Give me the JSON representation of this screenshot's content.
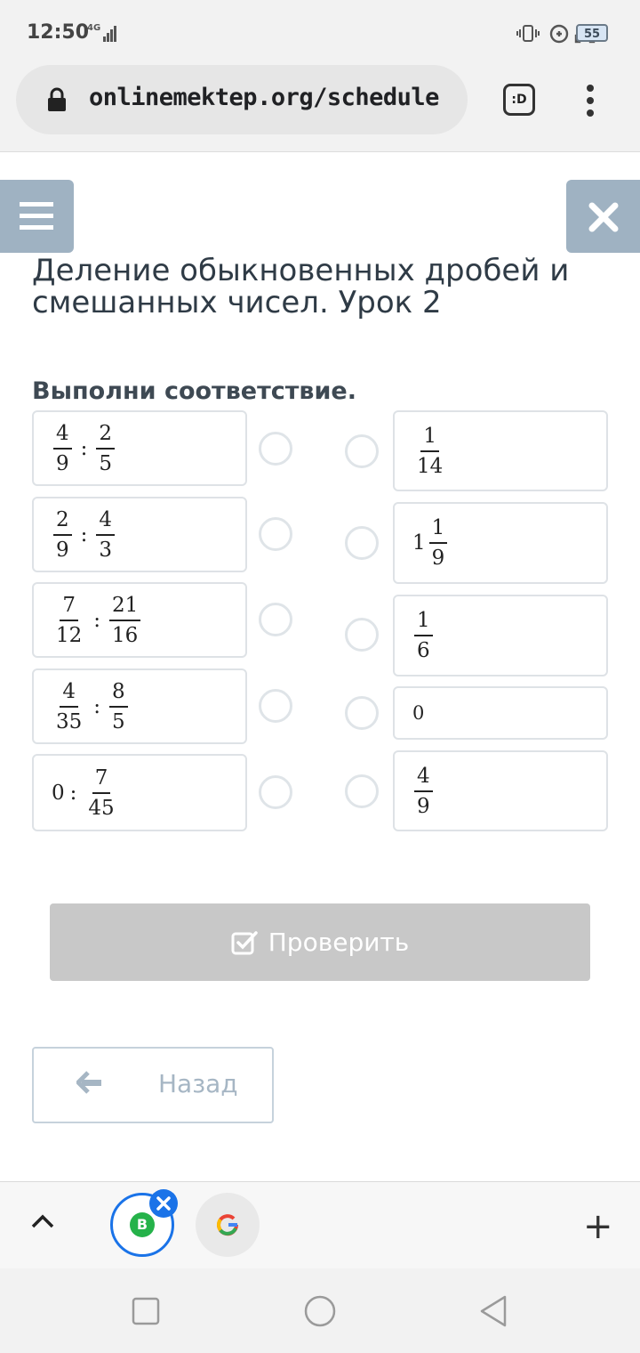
{
  "status_bar": {
    "time": "12:50",
    "network": "4G",
    "battery": "55"
  },
  "browser": {
    "url": "onlinemektep.org/schedule",
    "tabs_label": ":D"
  },
  "page": {
    "title": "Деление обыкновенных дробей и смешанных чисел. Урок 2",
    "task": "Выполни соответствие."
  },
  "left_items": [
    {
      "a_num": "4",
      "a_den": "9",
      "op": ":",
      "b_num": "2",
      "b_den": "5"
    },
    {
      "a_num": "2",
      "a_den": "9",
      "op": ":",
      "b_num": "4",
      "b_den": "3"
    },
    {
      "a_num": "7",
      "a_den": "12",
      "op": ":",
      "b_num": "21",
      "b_den": "16"
    },
    {
      "a_num": "4",
      "a_den": "35",
      "op": ":",
      "b_num": "8",
      "b_den": "5"
    },
    {
      "whole": "0",
      "op": ":",
      "b_num": "7",
      "b_den": "45"
    }
  ],
  "right_items": [
    {
      "num": "1",
      "den": "14"
    },
    {
      "whole": "1",
      "num": "1",
      "den": "9"
    },
    {
      "num": "1",
      "den": "6"
    },
    {
      "value": "0"
    },
    {
      "num": "4",
      "den": "9"
    }
  ],
  "buttons": {
    "check": "Проверить",
    "back": "Назад"
  },
  "colors": {
    "side_button": "#9fb2c2",
    "check_disabled": "#c8c8c8",
    "active_tab_ring": "#1a73e8"
  }
}
